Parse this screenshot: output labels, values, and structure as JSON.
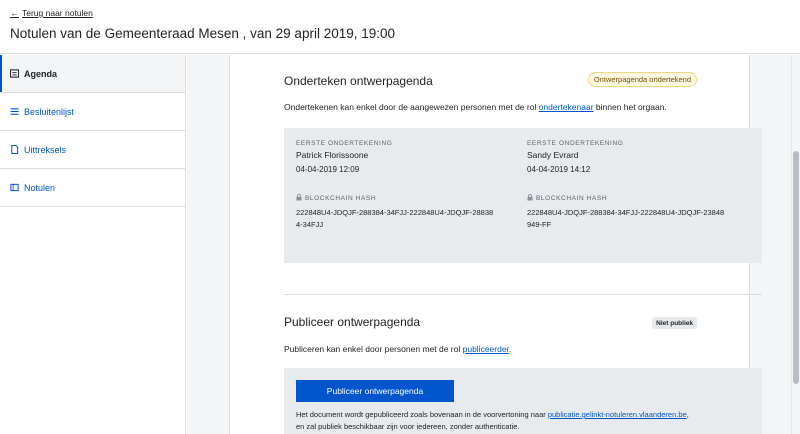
{
  "header": {
    "back_label": "Terug naar notulen",
    "title": "Notulen van de Gemeenteraad Mesen , van 29 april 2019, 19:00"
  },
  "sidebar": {
    "items": [
      {
        "label": "Agenda",
        "icon": "agenda-icon",
        "active": true
      },
      {
        "label": "Besluitenlijst",
        "icon": "list-icon",
        "active": false
      },
      {
        "label": "Uittreksels",
        "icon": "document-icon",
        "active": false
      },
      {
        "label": "Notulen",
        "icon": "notes-icon",
        "active": false
      }
    ]
  },
  "sign_section": {
    "title": "Onderteken ontwerpagenda",
    "status_pill": "Ontwerpagenda ondertekend",
    "desc_before": "Ondertekenen kan enkel door de aangewezen personen met de rol ",
    "desc_link": "ondertekenaar",
    "desc_after": " binnen het orgaan.",
    "signatures": [
      {
        "label": "EERSTE ONDERTEKENING",
        "name": "Patrick Florissoone",
        "date": "04-04-2019 12:09",
        "hash_label": "BLOCKCHAIN HASH",
        "hash": "222848U4-JDQJF-288384-34FJJ-222848U4-JDQJF-288384-34FJJ"
      },
      {
        "label": "EERSTE ONDERTEKENING",
        "name": "Sandy Evrard",
        "date": "04-04-2019 14:12",
        "hash_label": "BLOCKCHAIN HASH",
        "hash": "222848U4-JDQJF-288384-34FJJ-222848U4-JDQJF-23848949-FF"
      }
    ]
  },
  "publish_section": {
    "title": "Publiceer ontwerpagenda",
    "status_pill": "Niet publiek",
    "desc_before": "Publiceren kan enkel door personen met de rol ",
    "desc_link": "publiceerder",
    "desc_after": ".",
    "button_label": "Publiceer ontwerpagenda",
    "info_before": "Het document wordt gepubliceerd zoals bovenaan in de voorvertoning naar ",
    "info_link": "publicatie.gelinkt-notuleren.vlaanderen.be",
    "info_after": ",",
    "info_line2": "en zal publiek beschikbaar zijn voor iedereen, zonder authenticatie."
  },
  "colors": {
    "accent": "#0055cc",
    "signed_pill_bg": "#fff8e1",
    "panel_bg": "#e8ebee"
  }
}
